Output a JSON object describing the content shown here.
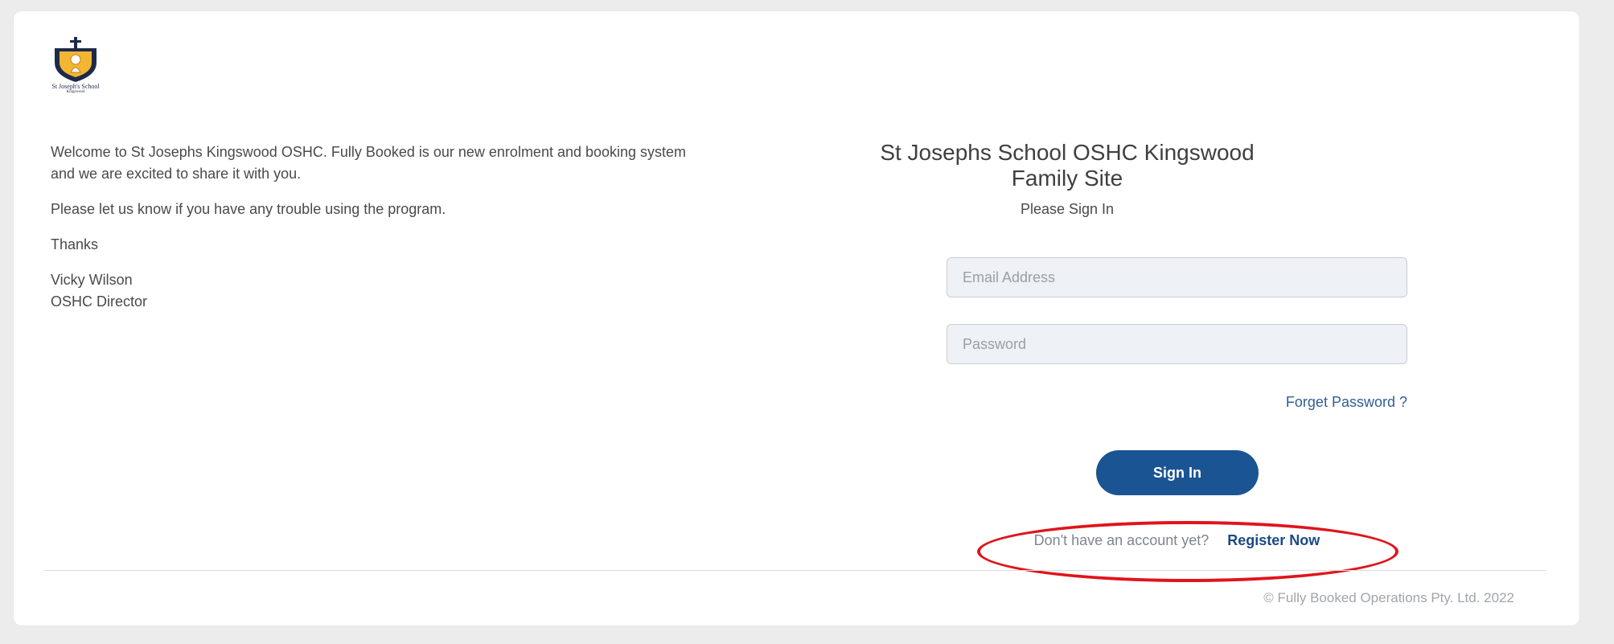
{
  "logo": {
    "caption": "St Joseph's School",
    "subcaption": "Kingswood"
  },
  "welcome": {
    "paragraph1_line1": "Welcome to St Josephs Kingswood OSHC. Fully Booked is our new enrolment and booking system",
    "paragraph1_line2": "and we are excited to share it with you.",
    "paragraph2": "Please let us know if you have any trouble using the program.",
    "paragraph3": "Thanks",
    "signature_name": "Vicky Wilson",
    "signature_title": "OSHC Director"
  },
  "signin": {
    "title_line1": "St Josephs School OSHC Kingswood",
    "title_line2": "Family Site",
    "subtitle": "Please Sign In",
    "email_placeholder": "Email Address",
    "password_placeholder": "Password",
    "forgot_label": "Forget Password ?",
    "button_label": "Sign In",
    "register_prompt": "Don't have an account yet?",
    "register_label": "Register Now"
  },
  "footer": {
    "copyright": "© Fully Booked Operations Pty. Ltd. 2022"
  },
  "colors": {
    "primary": "#1b5493",
    "highlight_ring": "#e0141b",
    "background": "#ececec"
  }
}
